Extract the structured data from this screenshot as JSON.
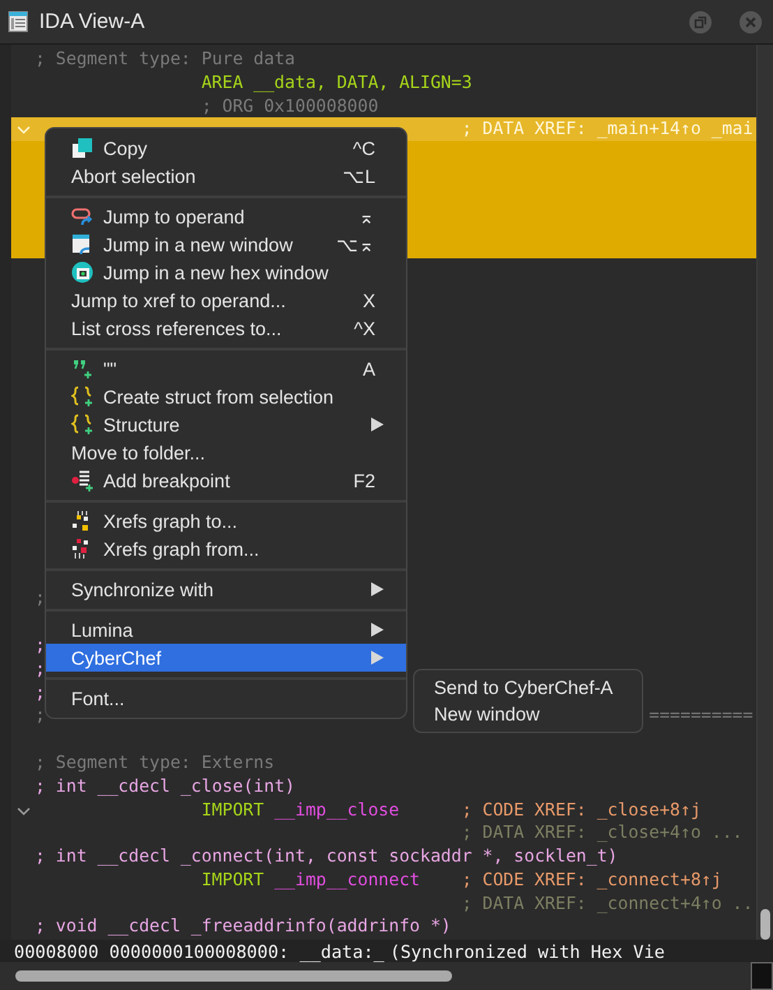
{
  "window": {
    "title": "IDA View-A"
  },
  "lines": [
    {
      "highlighted": false,
      "segments": [
        {
          "text": "; Segment type: Pure data",
          "kind": "comment"
        }
      ]
    },
    {
      "highlighted": false,
      "segments": [
        {
          "text": "AREA __data, DATA, ALIGN=3",
          "kind": "instruction"
        }
      ]
    },
    {
      "highlighted": false,
      "segments": [
        {
          "text": "; ORG 0x100008000",
          "kind": "org"
        }
      ]
    },
    {
      "highlighted": true,
      "foldable": true,
      "segments": [
        {
          "text": "; DATA XREF: _main+14↑o _mai",
          "kind": "xref_highlight"
        }
      ]
    },
    {
      "highlighted": true
    },
    {
      "highlighted": true
    },
    {
      "highlighted": true
    },
    {
      "highlighted": true
    },
    {
      "highlighted": true
    },
    {
      "highlighted": false
    },
    {
      "highlighted": false
    },
    {
      "highlighted": false
    },
    {
      "highlighted": false
    },
    {
      "highlighted": false
    },
    {
      "highlighted": false
    },
    {
      "highlighted": false
    },
    {
      "highlighted": false
    },
    {
      "highlighted": false
    },
    {
      "highlighted": false
    },
    {
      "highlighted": false
    },
    {
      "highlighted": false
    },
    {
      "highlighted": false
    },
    {
      "highlighted": false
    },
    {
      "highlighted": false,
      "segments": [
        {
          "text": ";",
          "kind": "comment"
        }
      ]
    },
    {
      "highlighted": false
    },
    {
      "highlighted": false,
      "segments": [
        {
          "text": ";",
          "kind": "prototype"
        }
      ]
    },
    {
      "highlighted": false,
      "segments": [
        {
          "text": ";",
          "kind": "prototype"
        }
      ]
    },
    {
      "highlighted": false,
      "segments": [
        {
          "text": ";",
          "kind": "prototype"
        }
      ]
    },
    {
      "highlighted": false,
      "segments": [
        {
          "text": ";",
          "kind": "comment"
        },
        {
          "text": "==========",
          "kind": "rule_tail"
        }
      ]
    },
    {
      "highlighted": false
    },
    {
      "highlighted": false,
      "segments": [
        {
          "text": "; Segment type: Externs",
          "kind": "comment"
        }
      ]
    },
    {
      "highlighted": false,
      "segments": [
        {
          "text": "; int __cdecl _close(int)",
          "kind": "prototype"
        }
      ]
    },
    {
      "highlighted": false,
      "foldable": true,
      "segments": [
        {
          "text": "IMPORT",
          "kind": "instruction"
        },
        {
          "text": "__imp__close",
          "kind": "name"
        },
        {
          "text": "; CODE XREF: _close+8↑j",
          "kind": "xref_code"
        }
      ]
    },
    {
      "highlighted": false,
      "segments": [
        {
          "text": "; DATA XREF: _close+4↑o ...",
          "kind": "xref_data"
        }
      ]
    },
    {
      "highlighted": false,
      "segments": [
        {
          "text": "; int __cdecl _connect(int, const sockaddr *, socklen_t)",
          "kind": "prototype"
        }
      ]
    },
    {
      "highlighted": false,
      "segments": [
        {
          "text": "IMPORT",
          "kind": "instruction"
        },
        {
          "text": "__imp__connect",
          "kind": "name"
        },
        {
          "text": "; CODE XREF: _connect+8↑j",
          "kind": "xref_code"
        }
      ]
    },
    {
      "highlighted": false,
      "segments": [
        {
          "text": "; DATA XREF: _connect+4↑o ..",
          "kind": "xref_data"
        }
      ]
    },
    {
      "highlighted": false,
      "segments": [
        {
          "text": "; void __cdecl _freeaddrinfo(addrinfo *)",
          "kind": "prototype"
        }
      ]
    }
  ],
  "context_menu": [
    {
      "kind": "copy",
      "label": "Copy",
      "shortcut": "^C",
      "submenu": false,
      "selected": false
    },
    {
      "kind": "plain",
      "label": "Abort selection",
      "shortcut": "⌥L",
      "submenu": false,
      "selected": false
    },
    {
      "kind": "separator"
    },
    {
      "kind": "link",
      "label": "Jump to operand",
      "shortcut": "⌅",
      "submenu": false,
      "selected": false
    },
    {
      "kind": "window",
      "label": "Jump in a new window",
      "shortcut": "⌥⌅",
      "submenu": false,
      "selected": false
    },
    {
      "kind": "hex",
      "label": "Jump in a new hex window",
      "submenu": false,
      "selected": false
    },
    {
      "kind": "plain",
      "label": "Jump to xref to operand...",
      "shortcut": "X",
      "submenu": false,
      "selected": false
    },
    {
      "kind": "plain",
      "label": "List cross references to...",
      "shortcut": "^X",
      "submenu": false,
      "selected": false
    },
    {
      "kind": "separator"
    },
    {
      "kind": "quotes",
      "label": "\"\"",
      "shortcut": "A",
      "submenu": false,
      "selected": false
    },
    {
      "kind": "braces",
      "label": "Create struct from selection",
      "submenu": false,
      "selected": false
    },
    {
      "kind": "braces",
      "label": "Structure",
      "submenu": true,
      "selected": false
    },
    {
      "kind": "plain",
      "label": "Move to folder...",
      "submenu": false,
      "selected": false
    },
    {
      "kind": "breakpoint",
      "label": "Add breakpoint",
      "shortcut": "F2",
      "submenu": false,
      "selected": false
    },
    {
      "kind": "separator"
    },
    {
      "kind": "graph_to",
      "label": "Xrefs graph to...",
      "submenu": false,
      "selected": false
    },
    {
      "kind": "graph_from",
      "label": "Xrefs graph from...",
      "submenu": false,
      "selected": false
    },
    {
      "kind": "separator"
    },
    {
      "kind": "plain",
      "label": "Synchronize with",
      "submenu": true,
      "selected": false
    },
    {
      "kind": "separator"
    },
    {
      "kind": "plain",
      "label": "Lumina",
      "submenu": true,
      "selected": false
    },
    {
      "kind": "plain",
      "label": "CyberChef",
      "submenu": true,
      "selected": true
    },
    {
      "kind": "separator"
    },
    {
      "kind": "plain",
      "label": "Font...",
      "submenu": false,
      "selected": false
    }
  ],
  "submenu": [
    "Send to CyberChef-A",
    "New window"
  ],
  "status_bar": {
    "address": "00008000 0000000100008000: __data:_",
    "sync": "(Synchronized with Hex Vie"
  }
}
